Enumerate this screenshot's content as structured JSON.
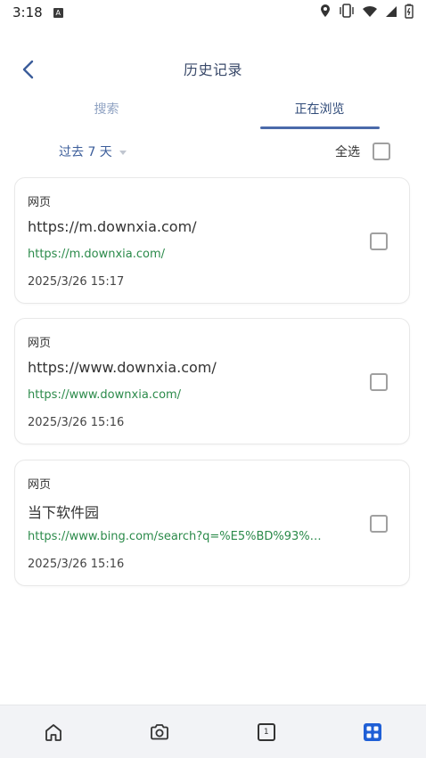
{
  "status_bar": {
    "time": "3:18",
    "badge": "A"
  },
  "header": {
    "title": "历史记录"
  },
  "tabs": [
    {
      "label": "搜索",
      "active": false
    },
    {
      "label": "正在浏览",
      "active": true
    }
  ],
  "filter": {
    "date_range": "过去 7 天",
    "select_all_label": "全选",
    "select_all_checked": false
  },
  "entries": [
    {
      "type": "网页",
      "title": "https://m.downxia.com/",
      "url": "https://m.downxia.com/",
      "time": "2025/3/26 15:17",
      "checked": false
    },
    {
      "type": "网页",
      "title": "https://www.downxia.com/",
      "url": "https://www.downxia.com/",
      "time": "2025/3/26 15:16",
      "checked": false
    },
    {
      "type": "网页",
      "title": "当下软件园",
      "url": "https://www.bing.com/search?q=%E5%BD%93%E4...",
      "time": "2025/3/26 15:16",
      "checked": false
    }
  ],
  "bottom_nav": {
    "items": [
      "home-icon",
      "camera-icon",
      "tabs-icon",
      "menu-grid-icon"
    ],
    "tab_count": "1",
    "active": "menu-grid-icon"
  },
  "colors": {
    "accent": "#3b5d9a",
    "url_green": "#2b8a4a",
    "active_nav": "#1f5fd6",
    "tab_underline": "#4a6aaa"
  }
}
